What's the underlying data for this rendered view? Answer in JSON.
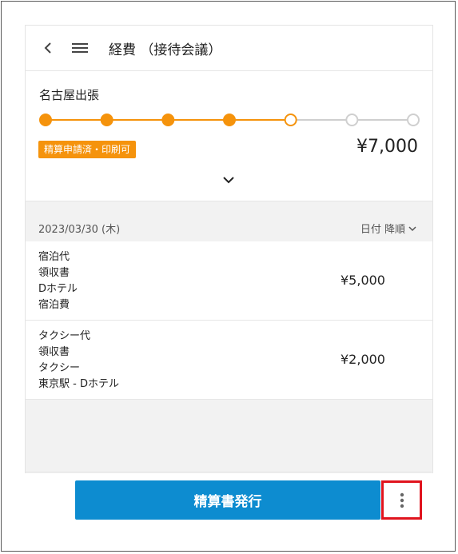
{
  "header": {
    "title": "経費 （接待会議）",
    "back_icon": "chevron-left-icon",
    "menu_icon": "hamburger-menu-icon"
  },
  "trip": {
    "name": "名古屋出張",
    "progress": {
      "total_steps": 7,
      "completed_steps": 4,
      "current_step": 5
    },
    "status": "精算申請済・印刷可",
    "total": "¥7,000"
  },
  "list": {
    "date": "2023/03/30 (木)",
    "sort_label": "日付 降順",
    "rows": [
      {
        "lines": [
          "宿泊代",
          "領収書",
          "Dホテル",
          "宿泊費"
        ],
        "amount": "¥5,000"
      },
      {
        "lines": [
          "タクシー代",
          "領収書",
          "タクシー",
          "東京駅 - Dホテル"
        ],
        "amount": "¥2,000"
      }
    ]
  },
  "footer": {
    "issue_button": "精算書発行",
    "more_icon": "more-vertical-icon"
  },
  "colors": {
    "accent_orange": "#f5930c",
    "primary_blue": "#0d8cd0",
    "highlight_red": "#e0141e"
  }
}
